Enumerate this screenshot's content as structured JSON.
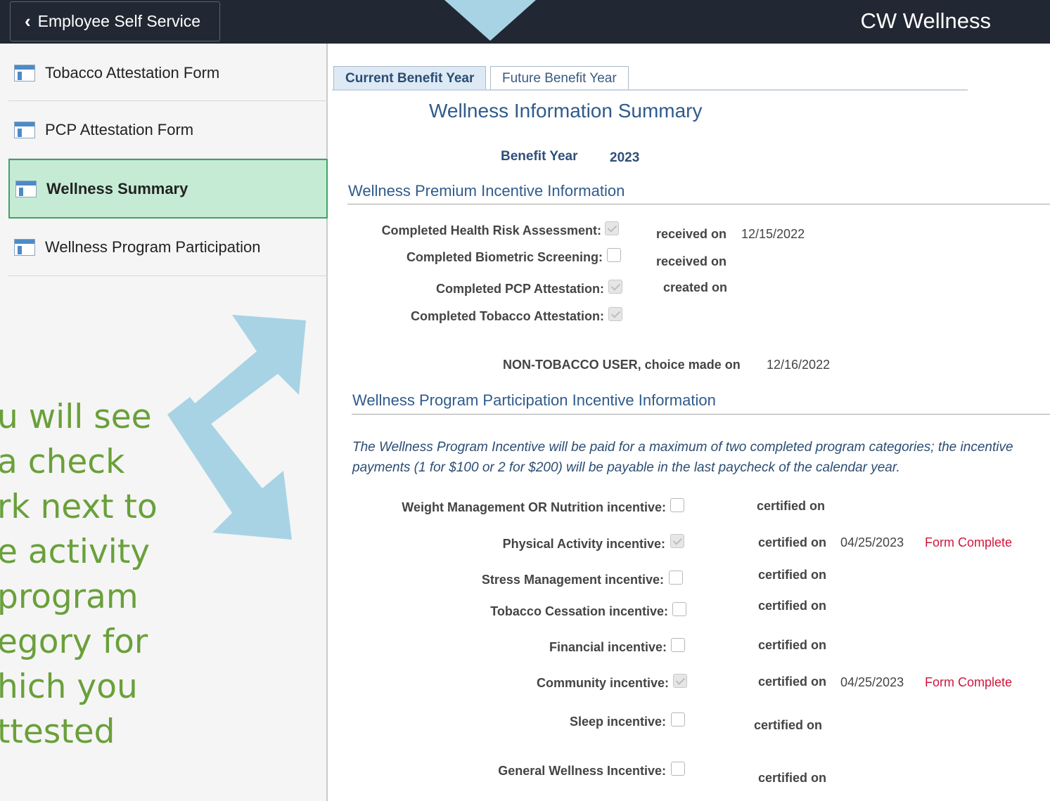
{
  "header": {
    "back_label": "Employee Self Service",
    "app_title": "CW Wellness",
    "back_icon": "chevron-left-icon",
    "background": "#212833"
  },
  "sidebar": {
    "items": [
      {
        "label": "Tobacco Attestation Form",
        "icon": "page-icon"
      },
      {
        "label": "PCP Attestation Form",
        "icon": "page-icon"
      },
      {
        "label": "Wellness Summary",
        "icon": "page-icon",
        "active": true
      },
      {
        "label": "Wellness Program Participation",
        "icon": "page-icon"
      }
    ],
    "active_color": "#c6ebd5"
  },
  "callout": {
    "lines": [
      "u will see",
      "a check",
      "rk next to",
      "e activity",
      " program",
      "egory for",
      "hich you",
      "ttested"
    ],
    "color": "#6aa03a",
    "arrow_color": "#a8d3e5"
  },
  "tabs": [
    {
      "label": "Current Benefit Year",
      "active": true
    },
    {
      "label": "Future Benefit Year",
      "active": false
    }
  ],
  "summary": {
    "title": "Wellness Information Summary",
    "benefit_year_label": "Benefit Year",
    "benefit_year_value": "2023"
  },
  "premium": {
    "title": "Wellness Premium Incentive Information",
    "rows": [
      {
        "label": "Completed Health Risk Assessment:",
        "checked": true,
        "meta_label": "received on",
        "meta_value": "12/15/2022"
      },
      {
        "label": "Completed Biometric Screening:",
        "checked": false,
        "meta_label": "received on",
        "meta_value": ""
      },
      {
        "label": "Completed PCP Attestation:",
        "checked": true,
        "meta_label": "created on",
        "meta_value": ""
      },
      {
        "label": "Completed Tobacco Attestation:",
        "checked": true,
        "meta_label": "",
        "meta_value": ""
      }
    ],
    "tobacco_status_label": "NON-TOBACCO USER, choice made on",
    "tobacco_status_date": "12/16/2022"
  },
  "participation": {
    "title": "Wellness Program Participation Incentive Information",
    "note": "The Wellness Program Incentive will be paid for a maximum of two completed program categories; the incentive payments (1 for $100 or 2 for $200) will be payable in the last paycheck of the calendar year.",
    "rows": [
      {
        "label": "Weight Management OR Nutrition incentive:",
        "checked": false,
        "meta_label": "certified on",
        "date": "",
        "status": ""
      },
      {
        "label": "Physical Activity incentive:",
        "checked": true,
        "meta_label": "certified on",
        "date": "04/25/2023",
        "status": "Form Complete"
      },
      {
        "label": "Stress Management incentive:",
        "checked": false,
        "meta_label": "certified on",
        "date": "",
        "status": ""
      },
      {
        "label": "Tobacco Cessation incentive:",
        "checked": false,
        "meta_label": "certified on",
        "date": "",
        "status": ""
      },
      {
        "label": "Financial incentive:",
        "checked": false,
        "meta_label": "certified on",
        "date": "",
        "status": ""
      },
      {
        "label": "Community incentive:",
        "checked": true,
        "meta_label": "certified on",
        "date": "04/25/2023",
        "status": "Form Complete"
      },
      {
        "label": "Sleep incentive:",
        "checked": false,
        "meta_label": "certified on",
        "date": "",
        "status": ""
      },
      {
        "label": "General Wellness Incentive:",
        "checked": false,
        "meta_label": "certified on",
        "date": "",
        "status": ""
      }
    ],
    "status_color": "#d1153d"
  }
}
